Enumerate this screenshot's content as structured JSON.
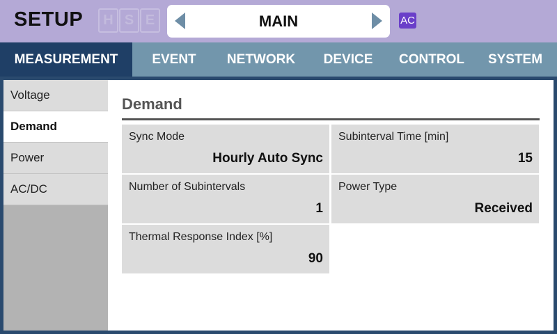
{
  "header": {
    "title": "SETUP",
    "indicators": [
      "H",
      "S",
      "E"
    ],
    "nav_title": "MAIN",
    "badge": "AC"
  },
  "tabs": [
    {
      "label": "MEASUREMENT",
      "active": true
    },
    {
      "label": "EVENT",
      "active": false
    },
    {
      "label": "NETWORK",
      "active": false
    },
    {
      "label": "DEVICE",
      "active": false
    },
    {
      "label": "CONTROL",
      "active": false
    },
    {
      "label": "SYSTEM",
      "active": false
    }
  ],
  "sidebar": {
    "items": [
      {
        "label": "Voltage",
        "active": false
      },
      {
        "label": "Demand",
        "active": true
      },
      {
        "label": "Power",
        "active": false
      },
      {
        "label": "AC/DC",
        "active": false
      }
    ]
  },
  "section": {
    "title": "Demand",
    "fields": [
      {
        "label": "Sync Mode",
        "value": "Hourly Auto Sync"
      },
      {
        "label": "Subinterval Time [min]",
        "value": "15"
      },
      {
        "label": "Number of Subintervals",
        "value": "1"
      },
      {
        "label": "Power Type",
        "value": "Received"
      },
      {
        "label": "Thermal Response Index [%]",
        "value": "90"
      }
    ]
  },
  "colors": {
    "header_bg": "#b4a9d6",
    "tab_bg": "#7296ac",
    "tab_active_bg": "#1f3f66",
    "badge_bg": "#6a3fc9"
  }
}
